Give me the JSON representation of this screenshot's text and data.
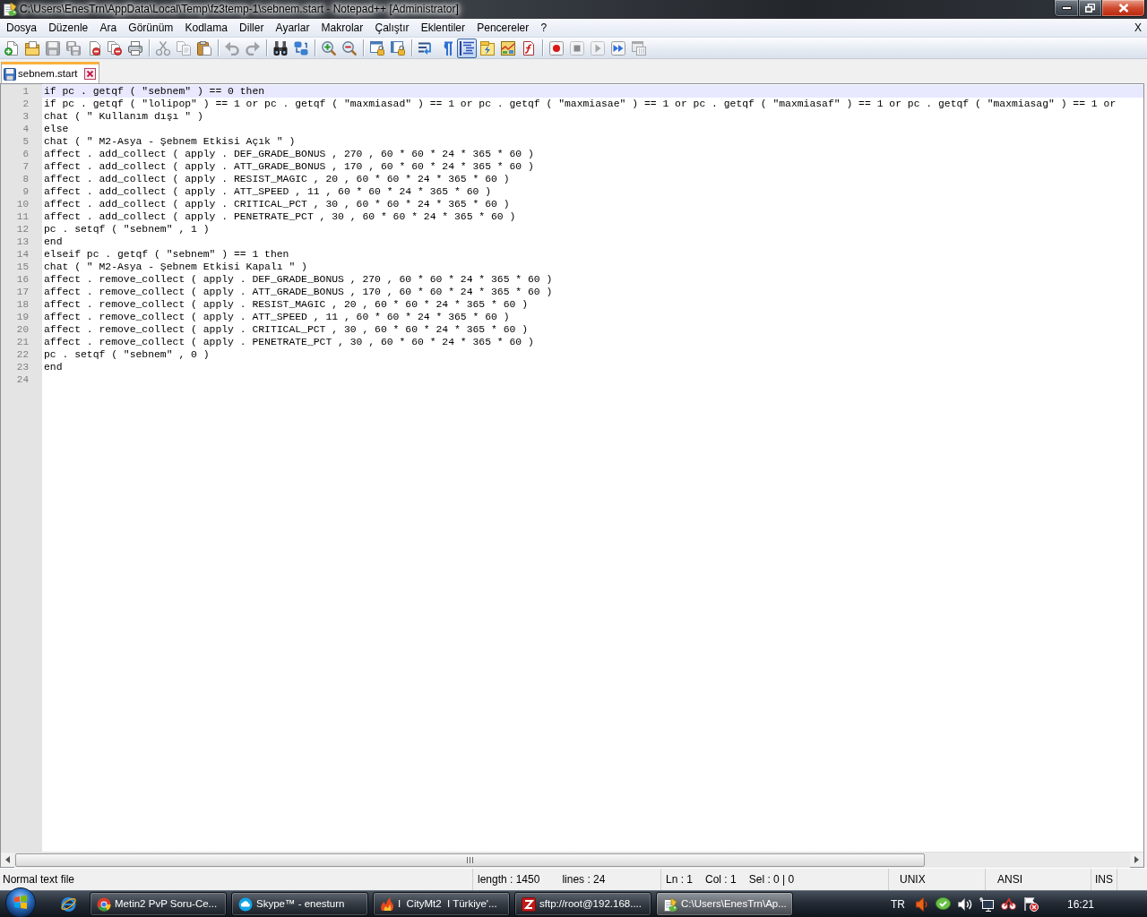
{
  "window": {
    "title": "C:\\Users\\EnesTrn\\AppData\\Local\\Temp\\fz3temp-1\\sebnem.start - Notepad++ [Administrator]"
  },
  "menu": {
    "items": [
      "Dosya",
      "Düzenle",
      "Ara",
      "Görünüm",
      "Kodlama",
      "Diller",
      "Ayarlar",
      "Makrolar",
      "Çalıştır",
      "Eklentiler",
      "Pencereler",
      "?"
    ],
    "close_document": "X"
  },
  "toolbar": [
    [
      {
        "pressed": false,
        "disabled": false
      },
      {
        "pressed": false,
        "disabled": false
      },
      {
        "pressed": false,
        "disabled": true
      },
      {
        "pressed": false,
        "disabled": true
      },
      {
        "pressed": false,
        "disabled": false
      },
      {
        "pressed": false,
        "disabled": false
      },
      {
        "pressed": false,
        "disabled": false
      }
    ],
    [
      {
        "pressed": false,
        "disabled": true
      },
      {
        "pressed": false,
        "disabled": true
      },
      {
        "pressed": false,
        "disabled": false
      }
    ],
    [
      {
        "pressed": false,
        "disabled": true
      },
      {
        "pressed": false,
        "disabled": true
      }
    ],
    [
      {
        "pressed": false,
        "disabled": false
      },
      {
        "pressed": false,
        "disabled": false
      }
    ],
    [
      {
        "pressed": false,
        "disabled": false
      },
      {
        "pressed": false,
        "disabled": false
      }
    ],
    [
      {
        "pressed": false,
        "disabled": false
      },
      {
        "pressed": false,
        "disabled": false
      }
    ],
    [
      {
        "pressed": false,
        "disabled": false
      },
      {
        "pressed": false,
        "disabled": false
      },
      {
        "pressed": true,
        "disabled": false
      },
      {
        "pressed": false,
        "disabled": false
      },
      {
        "pressed": false,
        "disabled": false
      },
      {
        "pressed": false,
        "disabled": false
      }
    ],
    [
      {
        "pressed": false,
        "disabled": false
      },
      {
        "pressed": false,
        "disabled": true
      },
      {
        "pressed": false,
        "disabled": true
      },
      {
        "pressed": false,
        "disabled": false
      },
      {
        "pressed": false,
        "disabled": true
      }
    ]
  ],
  "tabs": [
    {
      "label": "sebnem.start",
      "selected": true
    }
  ],
  "editor": {
    "lines": [
      {
        "number": "1",
        "text": "if pc . getqf ( \"sebnem\" ) == 0 then",
        "current": true
      },
      {
        "number": "2",
        "text": "if pc . getqf ( \"lolipop\" ) == 1 or pc . getqf ( \"maxmiasad\" ) == 1 or pc . getqf ( \"maxmiasae\" ) == 1 or pc . getqf ( \"maxmiasaf\" ) == 1 or pc . getqf ( \"maxmiasag\" ) == 1 or",
        "current": false
      },
      {
        "number": "3",
        "text": "chat ( \" Kullanım dışı \" )",
        "current": false
      },
      {
        "number": "4",
        "text": "else",
        "current": false
      },
      {
        "number": "5",
        "text": "chat ( \" M2-Asya - Şebnem Etkisi Açık \" )",
        "current": false
      },
      {
        "number": "6",
        "text": "affect . add_collect ( apply . DEF_GRADE_BONUS , 270 , 60 * 60 * 24 * 365 * 60 )",
        "current": false
      },
      {
        "number": "7",
        "text": "affect . add_collect ( apply . ATT_GRADE_BONUS , 170 , 60 * 60 * 24 * 365 * 60 )",
        "current": false
      },
      {
        "number": "8",
        "text": "affect . add_collect ( apply . RESIST_MAGIC , 20 , 60 * 60 * 24 * 365 * 60 )",
        "current": false
      },
      {
        "number": "9",
        "text": "affect . add_collect ( apply . ATT_SPEED , 11 , 60 * 60 * 24 * 365 * 60 )",
        "current": false
      },
      {
        "number": "10",
        "text": "affect . add_collect ( apply . CRITICAL_PCT , 30 , 60 * 60 * 24 * 365 * 60 )",
        "current": false
      },
      {
        "number": "11",
        "text": "affect . add_collect ( apply . PENETRATE_PCT , 30 , 60 * 60 * 24 * 365 * 60 )",
        "current": false
      },
      {
        "number": "12",
        "text": "pc . setqf ( \"sebnem\" , 1 )",
        "current": false
      },
      {
        "number": "13",
        "text": "end",
        "current": false
      },
      {
        "number": "14",
        "text": "elseif pc . getqf ( \"sebnem\" ) == 1 then",
        "current": false
      },
      {
        "number": "15",
        "text": "chat ( \" M2-Asya - Şebnem Etkisi Kapalı \" )",
        "current": false
      },
      {
        "number": "16",
        "text": "affect . remove_collect ( apply . DEF_GRADE_BONUS , 270 , 60 * 60 * 24 * 365 * 60 )",
        "current": false
      },
      {
        "number": "17",
        "text": "affect . remove_collect ( apply . ATT_GRADE_BONUS , 170 , 60 * 60 * 24 * 365 * 60 )",
        "current": false
      },
      {
        "number": "18",
        "text": "affect . remove_collect ( apply . RESIST_MAGIC , 20 , 60 * 60 * 24 * 365 * 60 )",
        "current": false
      },
      {
        "number": "19",
        "text": "affect . remove_collect ( apply . ATT_SPEED , 11 , 60 * 60 * 24 * 365 * 60 )",
        "current": false
      },
      {
        "number": "20",
        "text": "affect . remove_collect ( apply . CRITICAL_PCT , 30 , 60 * 60 * 24 * 365 * 60 )",
        "current": false
      },
      {
        "number": "21",
        "text": "affect . remove_collect ( apply . PENETRATE_PCT , 30 , 60 * 60 * 24 * 365 * 60 )",
        "current": false
      },
      {
        "number": "22",
        "text": "pc . setqf ( \"sebnem\" , 0 )",
        "current": false
      },
      {
        "number": "23",
        "text": "end",
        "current": false
      },
      {
        "number": "24",
        "current": false
      }
    ]
  },
  "status_bar": [
    {
      "texts": [
        "Normal text file"
      ]
    },
    {
      "texts": [
        "length : 1450",
        "lines : 24"
      ]
    },
    {
      "texts": [
        "Ln : 1",
        "Col : 1",
        "Sel : 0 | 0"
      ]
    },
    {
      "texts": [
        "UNIX"
      ]
    },
    {
      "texts": [
        "ANSI"
      ]
    },
    {
      "texts": [
        "INS"
      ]
    }
  ],
  "taskbar": {
    "buttons": [
      {
        "label": "Metin2 PvP Soru-Ce...",
        "selected": false
      },
      {
        "label": "Skype™ - enesturn",
        "selected": false
      },
      {
        "label": "I  CityMt2  I Türkiye'...",
        "selected": false
      },
      {
        "label": "sftp://root@192.168....",
        "selected": false
      },
      {
        "label": "C:\\Users\\EnesTrn\\Ap...",
        "selected": true
      }
    ],
    "language": "TR",
    "clock": "16:21"
  }
}
